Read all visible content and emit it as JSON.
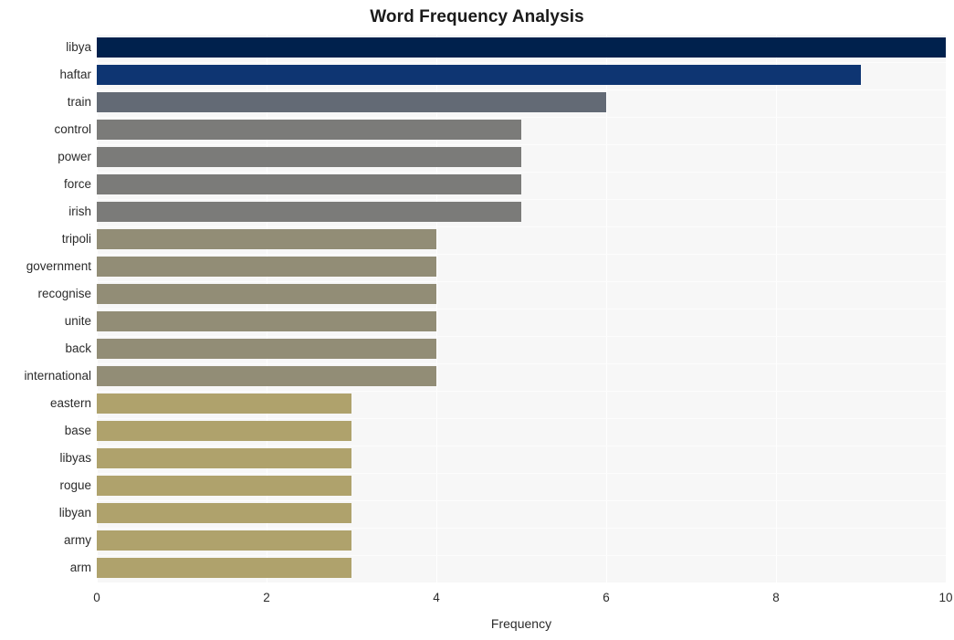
{
  "chart_data": {
    "type": "bar",
    "orientation": "horizontal",
    "title": "Word Frequency Analysis",
    "xlabel": "Frequency",
    "ylabel": "",
    "categories": [
      "libya",
      "haftar",
      "train",
      "control",
      "power",
      "force",
      "irish",
      "tripoli",
      "government",
      "recognise",
      "unite",
      "back",
      "international",
      "eastern",
      "base",
      "libyas",
      "rogue",
      "libyan",
      "army",
      "arm"
    ],
    "values": [
      10,
      9,
      6,
      5,
      5,
      5,
      5,
      4,
      4,
      4,
      4,
      4,
      4,
      3,
      3,
      3,
      3,
      3,
      3,
      3
    ],
    "bar_colors": [
      "#00214d",
      "#0e3572",
      "#636a75",
      "#7b7b79",
      "#7b7b79",
      "#7b7b79",
      "#7b7b79",
      "#928d76",
      "#928d76",
      "#928d76",
      "#928d76",
      "#928d76",
      "#928d76",
      "#afa26c",
      "#afa26c",
      "#afa26c",
      "#afa26c",
      "#afa26c",
      "#afa26c",
      "#afa26c"
    ],
    "xlim": [
      0,
      10
    ],
    "xticks": [
      0,
      2,
      4,
      6,
      8,
      10
    ],
    "xtick_labels": [
      "0",
      "2",
      "4",
      "6",
      "8",
      "10"
    ],
    "grid": true,
    "legend": "none",
    "plot_background": "#f7f7f7",
    "figure_background": "#ffffff"
  }
}
